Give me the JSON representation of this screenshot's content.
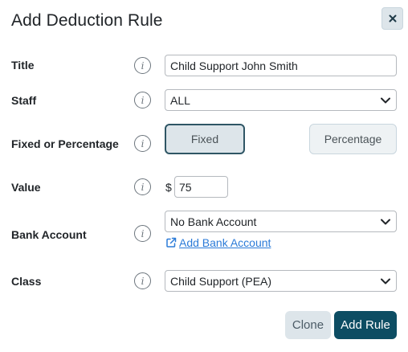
{
  "dialog": {
    "title": "Add Deduction Rule",
    "close_icon": "close-icon"
  },
  "form": {
    "title": {
      "label": "Title",
      "value": "Child Support John Smith"
    },
    "staff": {
      "label": "Staff",
      "selected": "ALL"
    },
    "fixed_or_percentage": {
      "label": "Fixed or Percentage",
      "options": [
        "Fixed",
        "Percentage"
      ],
      "selected": "Fixed"
    },
    "value": {
      "label": "Value",
      "currency_symbol": "$",
      "amount": "75"
    },
    "bank_account": {
      "label": "Bank Account",
      "selected": "No Bank Account",
      "add_link": "Add Bank Account"
    },
    "class": {
      "label": "Class",
      "selected": "Child Support (PEA)"
    },
    "info_icon": "info-icon"
  },
  "footer": {
    "clone_label": "Clone",
    "add_rule_label": "Add Rule"
  },
  "colors": {
    "primary": "#0d4d63",
    "secondary_bg": "#dde5ea",
    "link": "#2b7bd8"
  }
}
